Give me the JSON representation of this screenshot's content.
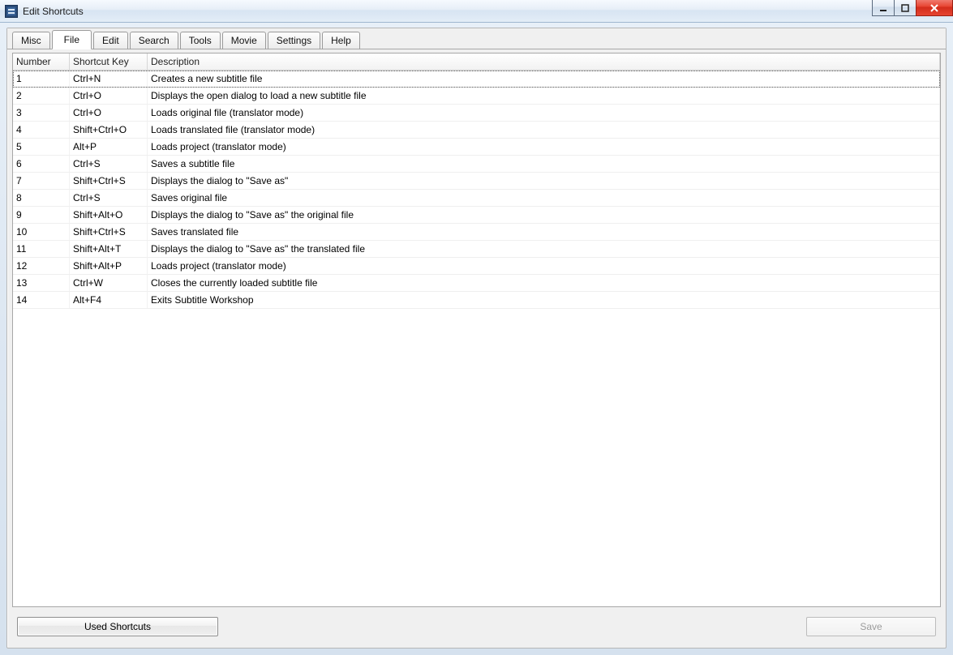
{
  "window": {
    "title": "Edit Shortcuts"
  },
  "tabs": [
    {
      "label": "Misc"
    },
    {
      "label": "File"
    },
    {
      "label": "Edit"
    },
    {
      "label": "Search"
    },
    {
      "label": "Tools"
    },
    {
      "label": "Movie"
    },
    {
      "label": "Settings"
    },
    {
      "label": "Help"
    }
  ],
  "active_tab_index": 1,
  "columns": {
    "number": "Number",
    "key": "Shortcut Key",
    "description": "Description"
  },
  "rows": [
    {
      "number": "1",
      "key": "Ctrl+N",
      "description": "Creates a new subtitle file"
    },
    {
      "number": "2",
      "key": "Ctrl+O",
      "description": "Displays the open dialog to load a new subtitle file"
    },
    {
      "number": "3",
      "key": "Ctrl+O",
      "description": "Loads original file (translator mode)"
    },
    {
      "number": "4",
      "key": "Shift+Ctrl+O",
      "description": "Loads translated file (translator mode)"
    },
    {
      "number": "5",
      "key": "Alt+P",
      "description": "Loads project (translator mode)"
    },
    {
      "number": "6",
      "key": "Ctrl+S",
      "description": "Saves a subtitle file"
    },
    {
      "number": "7",
      "key": "Shift+Ctrl+S",
      "description": "Displays the dialog to \"Save as\""
    },
    {
      "number": "8",
      "key": "Ctrl+S",
      "description": "Saves original file"
    },
    {
      "number": "9",
      "key": "Shift+Alt+O",
      "description": "Displays the dialog to \"Save as\" the original file"
    },
    {
      "number": "10",
      "key": "Shift+Ctrl+S",
      "description": "Saves translated file"
    },
    {
      "number": "11",
      "key": "Shift+Alt+T",
      "description": "Displays the dialog to \"Save as\" the translated file"
    },
    {
      "number": "12",
      "key": "Shift+Alt+P",
      "description": "Loads project (translator mode)"
    },
    {
      "number": "13",
      "key": "Ctrl+W",
      "description": "Closes the currently loaded subtitle file"
    },
    {
      "number": "14",
      "key": "Alt+F4",
      "description": "Exits Subtitle Workshop"
    }
  ],
  "selected_row_index": 0,
  "buttons": {
    "used": "Used Shortcuts",
    "save": "Save"
  }
}
